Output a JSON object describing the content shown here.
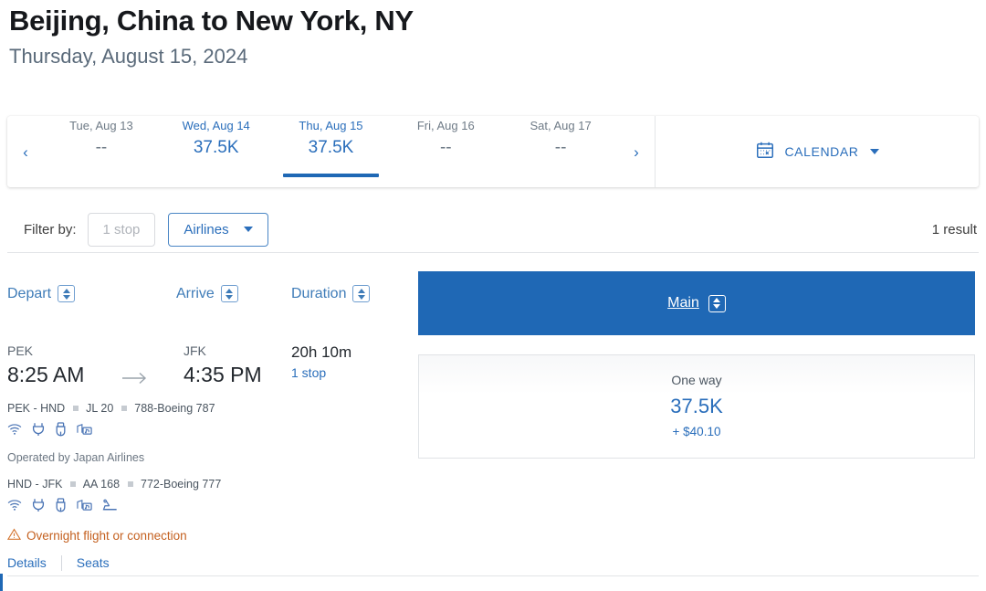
{
  "header": {
    "route_title": "Beijing, China to New York, NY",
    "trip_date": "Thursday, August 15, 2024"
  },
  "date_strip": {
    "prev_arrow": "‹",
    "next_arrow": "›",
    "dates": [
      {
        "label": "Tue, Aug 13",
        "price": "--",
        "selected": false,
        "has_price": false
      },
      {
        "label": "Wed, Aug 14",
        "price": "37.5K",
        "selected": false,
        "has_price": true
      },
      {
        "label": "Thu, Aug 15",
        "price": "37.5K",
        "selected": true,
        "has_price": true
      },
      {
        "label": "Fri, Aug 16",
        "price": "--",
        "selected": false,
        "has_price": false
      },
      {
        "label": "Sat, Aug 17",
        "price": "--",
        "selected": false,
        "has_price": false
      }
    ],
    "calendar_label": "CALENDAR"
  },
  "filters": {
    "filter_by_label": "Filter by:",
    "stops_chip": "1 stop",
    "airlines_chip": "Airlines",
    "result_count": "1 result"
  },
  "sort_headers": {
    "depart": "Depart",
    "arrive": "Arrive",
    "duration": "Duration"
  },
  "fare_column": {
    "cabin_label": "Main"
  },
  "flight": {
    "depart_airport": "PEK",
    "depart_time": "8:25 AM",
    "arrive_airport": "JFK",
    "arrive_time": "4:35 PM",
    "duration": "20h 10m",
    "stops": "1 stop",
    "segment_1": {
      "route": "PEK - HND",
      "flight_number": "JL 20",
      "aircraft": "788-Boeing 787",
      "amenities": [
        "wifi-icon",
        "power-outlet-icon",
        "usb-port-icon",
        "entertainment-icon"
      ]
    },
    "operated_by": "Operated by Japan Airlines",
    "segment_2": {
      "route": "HND - JFK",
      "flight_number": "AA 168",
      "aircraft": "772-Boeing 777",
      "amenities": [
        "wifi-icon",
        "power-outlet-icon",
        "usb-port-icon",
        "entertainment-icon",
        "lie-flat-seat-icon"
      ]
    },
    "overnight_warning": "Overnight flight or connection",
    "details_link": "Details",
    "seats_link": "Seats"
  },
  "fare_card": {
    "trip_type": "One way",
    "points": "37.5K",
    "taxes": "+ $40.10"
  },
  "colors": {
    "brand_blue": "#1f68b5",
    "link_blue": "#2a6ebb",
    "warning_orange": "#c4601f",
    "muted_gray": "#6f7b87"
  }
}
